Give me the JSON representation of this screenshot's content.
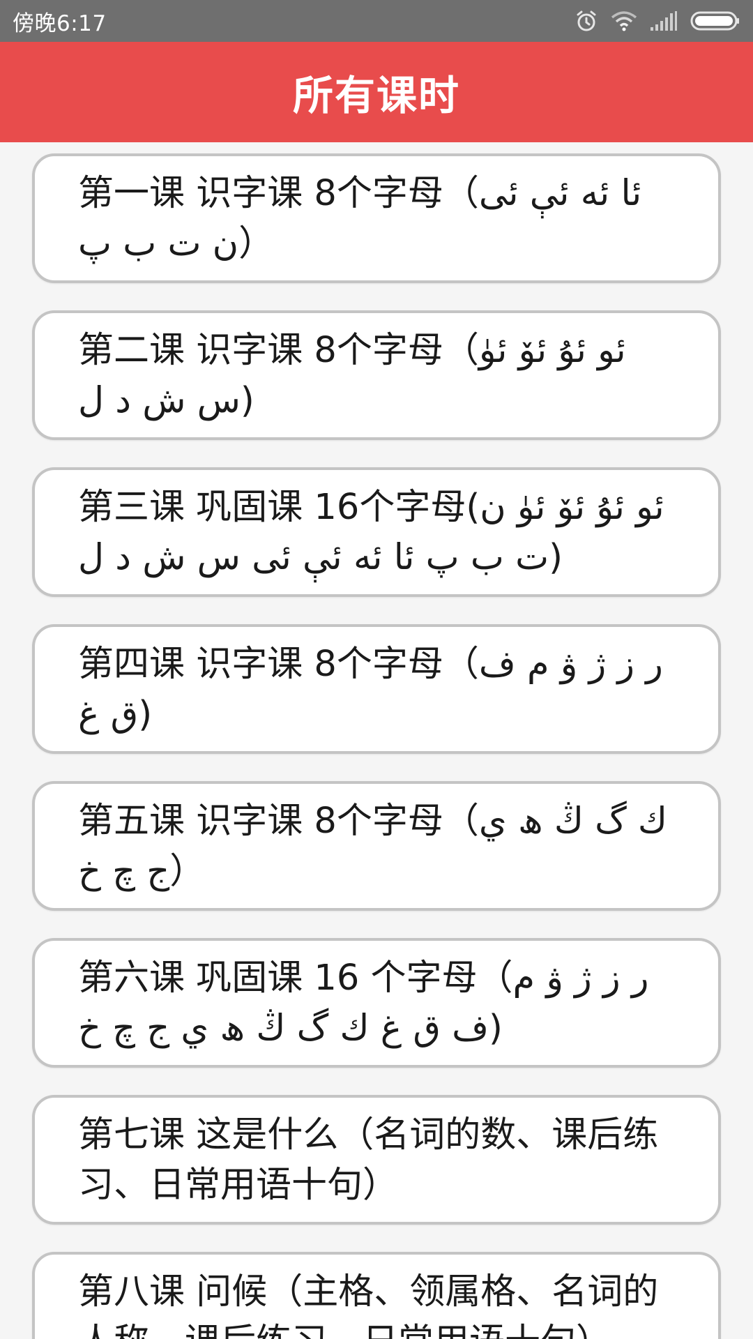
{
  "status_bar": {
    "time": "傍晚6:17",
    "icons": [
      "alarm-icon",
      "wifi-icon",
      "signal-icon",
      "battery-icon"
    ]
  },
  "header": {
    "title": "所有课时"
  },
  "lessons": [
    {
      "title": "第一课  识字课 8个字母（ئا ئە ئې ئى ن ت ب پ）"
    },
    {
      "title": "第二课 识字课 8个字母（ئو ئۇ ئۆ ئۈ س ش د ل)"
    },
    {
      "title": "第三课 巩固课 16个字母(ئو ئۇ ئۆ ئۈ ن ت ب پ  ئا ئە ئې ئى س ش د ل)"
    },
    {
      "title": "第四课 识字课 8个字母（ر ز ژ ۋ م ف ق غ)"
    },
    {
      "title": "第五课 识字课 8个字母（ك گ ڭ ھ ي ج چ خ）"
    },
    {
      "title": "第六课 巩固课 16 个字母（ر ز ژ ۋ م ف ق غ ك گ ڭ ھ ي ج چ خ)"
    },
    {
      "title": "第七课 这是什么（名词的数、课后练习、日常用语十句）"
    },
    {
      "title": "第八课 问候（主格、领属格、名词的人称、课后练习、日常用语十句）"
    }
  ],
  "colors": {
    "status_bar": "#6f6f6f",
    "app_bar": "#e84c4c",
    "background": "#f5f5f5",
    "card_border": "#c4c4c4"
  }
}
